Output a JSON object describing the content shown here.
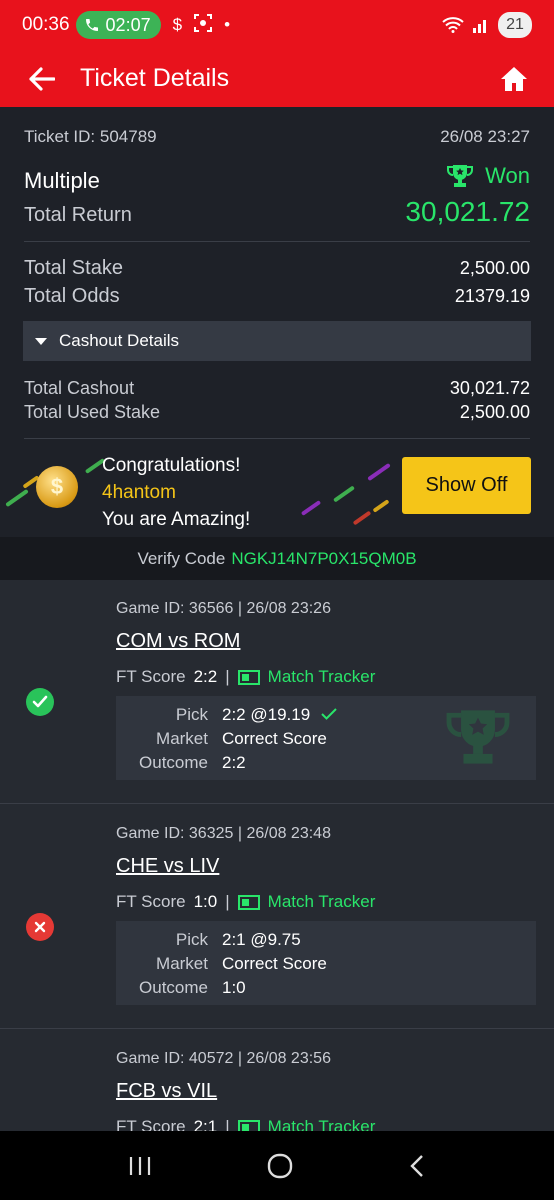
{
  "status_bar": {
    "time": "00:36",
    "call_timer": "02:07",
    "battery": "21"
  },
  "header": {
    "title": "Ticket Details"
  },
  "ticket": {
    "id_label": "Ticket ID: 504789",
    "date": "26/08 23:27",
    "bet_type": "Multiple",
    "result": "Won",
    "total_return_label": "Total Return",
    "total_return": "30,021.72",
    "total_stake_label": "Total Stake",
    "total_stake": "2,500.00",
    "total_odds_label": "Total Odds",
    "total_odds": "21379.19"
  },
  "cashout": {
    "toggle_label": "Cashout Details",
    "total_cashout_label": "Total Cashout",
    "total_cashout": "30,021.72",
    "total_used_stake_label": "Total Used Stake",
    "total_used_stake": "2,500.00"
  },
  "congrats": {
    "line1": "Congratulations!",
    "username": "4hantom",
    "line3": "You are Amazing!",
    "button": "Show Off"
  },
  "verify": {
    "label": "Verify Code",
    "code": "NGKJ14N7P0X15QM0B"
  },
  "games": [
    {
      "meta": "Game ID: 36566 | 26/08 23:26",
      "teams": "COM vs ROM",
      "ft_label": "FT Score",
      "ft_score": "2:2",
      "tracker": "Match Tracker",
      "pick_label": "Pick",
      "pick": "2:2 @19.19",
      "market_label": "Market",
      "market": "Correct Score",
      "outcome_label": "Outcome",
      "outcome": "2:2",
      "status": "won"
    },
    {
      "meta": "Game ID: 36325 | 26/08 23:48",
      "teams": "CHE vs LIV",
      "ft_label": "FT Score",
      "ft_score": "1:0",
      "tracker": "Match Tracker",
      "pick_label": "Pick",
      "pick": "2:1 @9.75",
      "market_label": "Market",
      "market": "Correct Score",
      "outcome_label": "Outcome",
      "outcome": "1:0",
      "status": "lost"
    },
    {
      "meta": "Game ID: 40572 | 26/08 23:56",
      "teams": "FCB vs VIL",
      "ft_label": "FT Score",
      "ft_score": "2:1",
      "tracker": "Match Tracker"
    }
  ],
  "colors": {
    "brand_red": "#e8121c",
    "win_green": "#29e56a",
    "lose_red": "#e53935",
    "gold": "#f5c518"
  }
}
